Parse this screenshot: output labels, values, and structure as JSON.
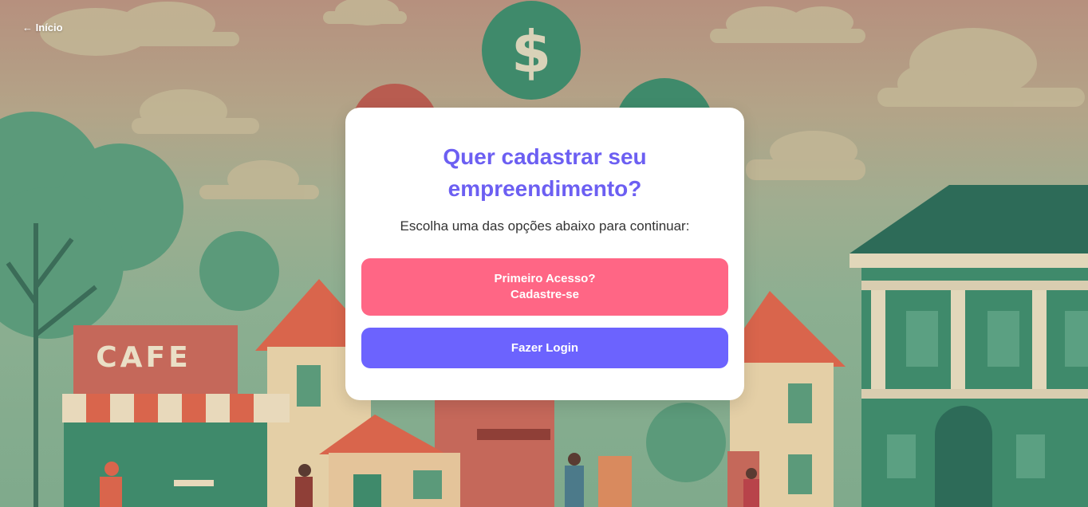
{
  "nav": {
    "back_label": "← Início"
  },
  "background": {
    "cafe_sign": "CAFE"
  },
  "card": {
    "title_line1": "Quer cadastrar seu",
    "title_line2": "empreendimento?",
    "subtitle": "Escolha uma das opções abaixo para continuar:",
    "signup_line1": "Primeiro Acesso?",
    "signup_line2": "Cadastre-se",
    "login_label": "Fazer Login"
  },
  "colors": {
    "title": "#6c5ff2",
    "signup_button": "#ff6685",
    "login_button": "#6c63fe",
    "card": "#ffffff"
  }
}
